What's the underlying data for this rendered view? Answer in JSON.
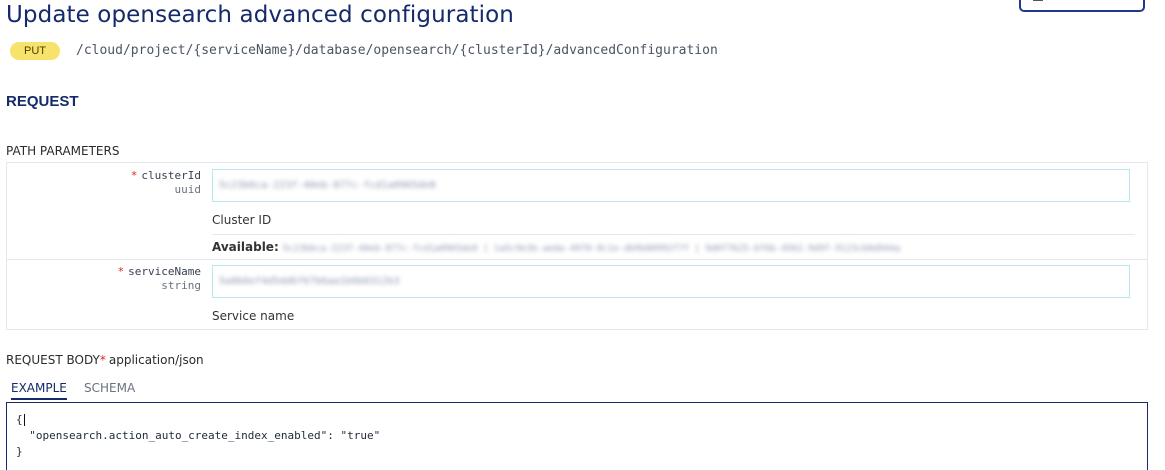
{
  "page": {
    "title": "Update opensearch advanced configuration",
    "method": "PUT",
    "path": "/cloud/project/{serviceName}/database/opensearch/{clusterId}/advancedConfiguration"
  },
  "request": {
    "heading": "REQUEST",
    "path_parameters_title": "PATH PARAMETERS",
    "params": [
      {
        "name": "clusterId",
        "type": "uuid",
        "required_marker": "*",
        "value": "5c23b6ca-223f-40eb-877c-fcd1a0965de8",
        "description": "Cluster ID",
        "available_label": "Available:",
        "available_values": "5c23b6ca-223f-40eb-877c-fcd1a0965de8 | 1a5c9e3b-aeda-4970-8c1e-db9b80992f7f | 9d0f7625-6f6b-4562-9d9f-9123cb0d944a"
      },
      {
        "name": "serviceName",
        "type": "string",
        "required_marker": "*",
        "value": "5a0b6ef4d5dd6f67b6aa1b6b0312b3",
        "description": "Service name"
      }
    ],
    "body": {
      "title": "REQUEST BODY",
      "required_marker": "*",
      "content_type": "application/json",
      "tabs": [
        "EXAMPLE",
        "SCHEMA"
      ],
      "code_lines": [
        "{",
        "  \"opensearch.action_auto_create_index_enabled\": \"true\"",
        "}"
      ]
    }
  }
}
